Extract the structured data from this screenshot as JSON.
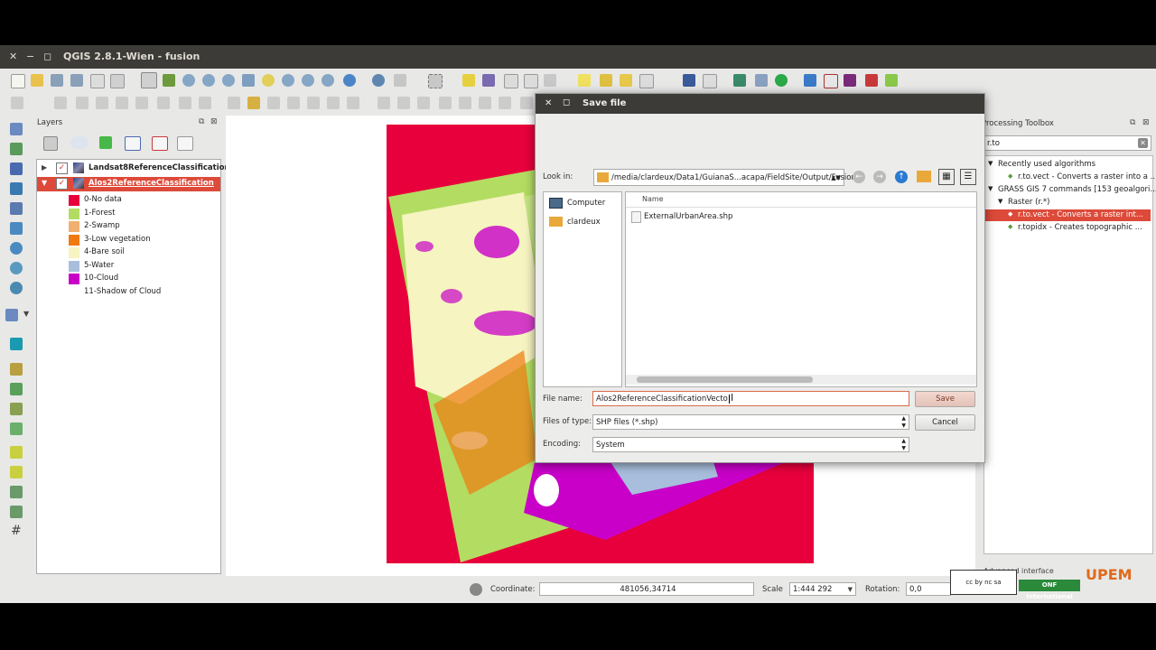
{
  "window": {
    "title": "QGIS 2.8.1-Wien - fusion"
  },
  "layers_panel": {
    "title": "Layers",
    "layers": [
      {
        "name": "Landsat8ReferenceClassification",
        "checked": true,
        "expanded": false
      },
      {
        "name": "Alos2ReferenceClassification",
        "checked": true,
        "expanded": true,
        "selected": true
      }
    ],
    "legend": [
      {
        "label": "0-No data",
        "color": "#e8003c"
      },
      {
        "label": "1-Forest",
        "color": "#b3dc62"
      },
      {
        "label": "2-Swamp",
        "color": "#f0b070"
      },
      {
        "label": "3-Low vegetation",
        "color": "#f07a10"
      },
      {
        "label": "4-Bare soil",
        "color": "#f6f4c0"
      },
      {
        "label": "5-Water",
        "color": "#a8bedc"
      },
      {
        "label": "10-Cloud",
        "color": "#c800c8"
      },
      {
        "label": "11-Shadow of Cloud",
        "color": "#ffffff"
      }
    ]
  },
  "processing": {
    "title": "Processing Toolbox",
    "search_value": "r.to",
    "tree": [
      {
        "label": "Recently used algorithms",
        "level": 0
      },
      {
        "label": "r.to.vect - Converts a raster into a ...",
        "level": 2
      },
      {
        "label": "GRASS GIS 7 commands [153 geoalgori...",
        "level": 0
      },
      {
        "label": "Raster (r.*)",
        "level": 1
      },
      {
        "label": "r.to.vect - Converts a raster int...",
        "level": 2,
        "selected": true
      },
      {
        "label": "r.topidx - Creates topographic ...",
        "level": 2
      }
    ],
    "advanced": "Advanced interface"
  },
  "statusbar": {
    "coordinate_label": "Coordinate:",
    "coordinate_value": "481056,34714",
    "scale_label": "Scale",
    "scale_value": "1:444 292",
    "rotation_label": "Rotation:",
    "rotation_value": "0,0"
  },
  "dialog": {
    "title": "Save file",
    "look_in_label": "Look in:",
    "look_in_path": "/media/clardeux/Data1/GuianaS...acapa/FieldSite/Output/Fusion",
    "places": [
      "Computer",
      "clardeux"
    ],
    "column_name": "Name",
    "files": [
      "ExternalUrbanArea.shp"
    ],
    "file_name_label": "File name:",
    "file_name_value": "Alos2ReferenceClassificationVecto",
    "files_of_type_label": "Files of type:",
    "files_of_type_value": "SHP files (*.shp)",
    "encoding_label": "Encoding:",
    "encoding_value": "System",
    "save_label": "Save",
    "cancel_label": "Cancel"
  },
  "logos": {
    "onf": "ONF International",
    "upem": "UPEM"
  }
}
